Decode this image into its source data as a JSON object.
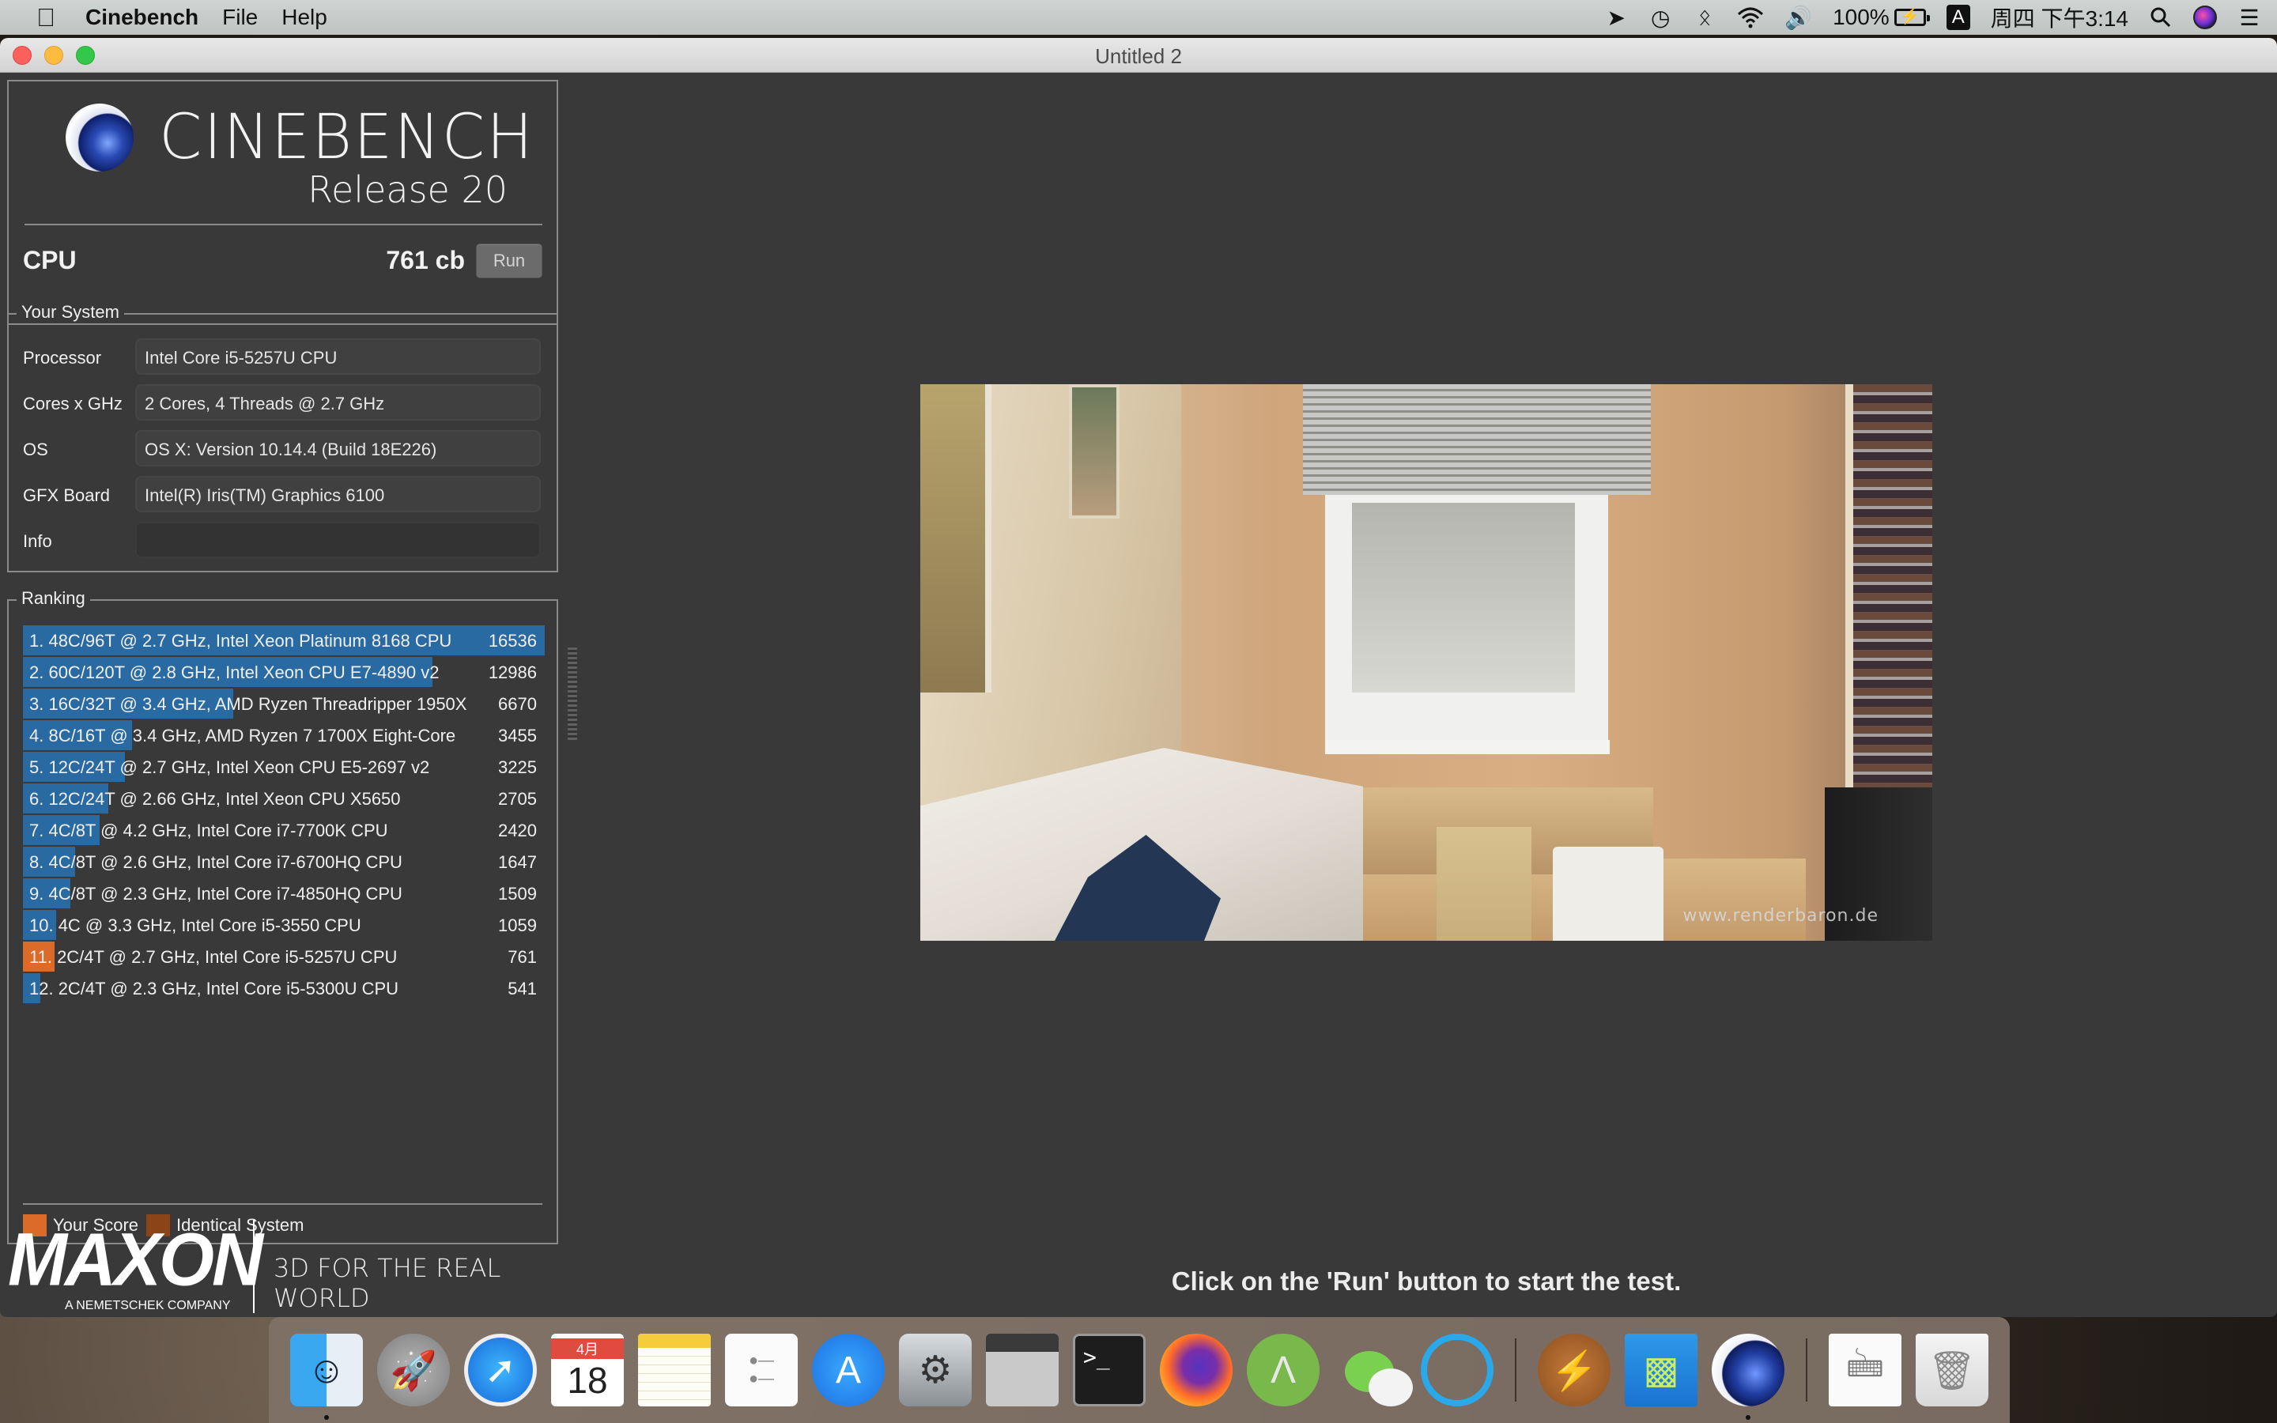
{
  "menubar": {
    "apple_icon": "apple-logo-icon",
    "app_name": "Cinebench",
    "menus": [
      "File",
      "Help"
    ],
    "status_icons": [
      "paper-plane-icon",
      "time-machine-icon",
      "bluetooth-icon",
      "wifi-icon",
      "volume-icon"
    ],
    "battery_percent": "100%",
    "input_method": "A",
    "clock": "周四 下午3:14",
    "right_icons": [
      "spotlight-search-icon",
      "siri-icon",
      "notification-center-icon"
    ]
  },
  "window": {
    "title": "Untitled 2"
  },
  "logo": {
    "name": "CINEBENCH",
    "release": "Release 20"
  },
  "benchmark": {
    "label": "CPU",
    "score": "761 cb",
    "run_label": "Run"
  },
  "system": {
    "title": "Your System",
    "rows": [
      {
        "label": "Processor",
        "value": "Intel Core i5-5257U CPU"
      },
      {
        "label": "Cores x GHz",
        "value": "2 Cores, 4 Threads @ 2.7 GHz"
      },
      {
        "label": "OS",
        "value": "OS X: Version 10.14.4 (Build 18E226)"
      },
      {
        "label": "GFX Board",
        "value": "Intel(R) Iris(TM) Graphics 6100"
      },
      {
        "label": "Info",
        "value": ""
      }
    ]
  },
  "ranking": {
    "title": "Ranking",
    "max_score": 16536,
    "items": [
      {
        "text": "1. 48C/96T @ 2.7 GHz, Intel Xeon Platinum 8168 CPU",
        "score": 16536,
        "is_you": false
      },
      {
        "text": "2. 60C/120T @ 2.8 GHz, Intel Xeon CPU E7-4890 v2",
        "score": 12986,
        "is_you": false
      },
      {
        "text": "3. 16C/32T @ 3.4 GHz, AMD Ryzen Threadripper 1950X",
        "score": 6670,
        "is_you": false
      },
      {
        "text": "4. 8C/16T @ 3.4 GHz, AMD Ryzen 7 1700X Eight-Core",
        "score": 3455,
        "is_you": false
      },
      {
        "text": "5. 12C/24T @ 2.7 GHz, Intel Xeon CPU E5-2697 v2",
        "score": 3225,
        "is_you": false
      },
      {
        "text": "6. 12C/24T @ 2.66 GHz, Intel Xeon CPU X5650",
        "score": 2705,
        "is_you": false
      },
      {
        "text": "7. 4C/8T @ 4.2 GHz, Intel Core i7-7700K CPU",
        "score": 2420,
        "is_you": false
      },
      {
        "text": "8. 4C/8T @ 2.6 GHz, Intel Core i7-6700HQ CPU",
        "score": 1647,
        "is_you": false
      },
      {
        "text": "9. 4C/8T @ 2.3 GHz, Intel Core i7-4850HQ CPU",
        "score": 1509,
        "is_you": false
      },
      {
        "text": "10. 4C @ 3.3 GHz, Intel Core i5-3550 CPU",
        "score": 1059,
        "is_you": false
      },
      {
        "text": "11. 2C/4T @ 2.7 GHz, Intel Core i5-5257U CPU",
        "score": 761,
        "is_you": true
      },
      {
        "text": "12. 2C/4T @ 2.3 GHz, Intel Core i5-5300U CPU",
        "score": 541,
        "is_you": false
      }
    ],
    "legend": {
      "your_score": "Your Score",
      "identical_system": "Identical System"
    },
    "colors": {
      "bar": "#2a6aa3",
      "your_score": "#dc6a28",
      "identical_system": "#8a4418"
    }
  },
  "branding": {
    "company": "MAXON",
    "company_sub": "A NEMETSCHEK COMPANY",
    "slogan": "3D FOR THE REAL WORLD"
  },
  "render": {
    "watermark": "www.renderbaron.de"
  },
  "status": {
    "message": "Click on the 'Run' button to start the test."
  },
  "dock": {
    "calendar_month": "4月",
    "calendar_day": "18",
    "items": [
      {
        "name": "Finder",
        "running": true
      },
      {
        "name": "Launchpad",
        "running": false
      },
      {
        "name": "Safari",
        "running": false
      },
      {
        "name": "Calendar",
        "running": false
      },
      {
        "name": "Notes",
        "running": false
      },
      {
        "name": "Reminders",
        "running": false
      },
      {
        "name": "App Store",
        "running": false
      },
      {
        "name": "System Preferences",
        "running": false
      },
      {
        "name": "Calculator",
        "running": false
      },
      {
        "name": "Terminal",
        "running": false
      },
      {
        "name": "Firefox",
        "running": false
      },
      {
        "name": "Android Studio",
        "running": false
      },
      {
        "name": "WeChat",
        "running": false
      },
      {
        "name": "QQ",
        "running": false
      },
      {
        "name": "Amphetamine",
        "running": false
      },
      {
        "name": "Geekbench",
        "running": false
      },
      {
        "name": "Cinebench",
        "running": true
      },
      {
        "name": "Disk",
        "running": false
      },
      {
        "name": "Trash",
        "running": false
      }
    ]
  }
}
